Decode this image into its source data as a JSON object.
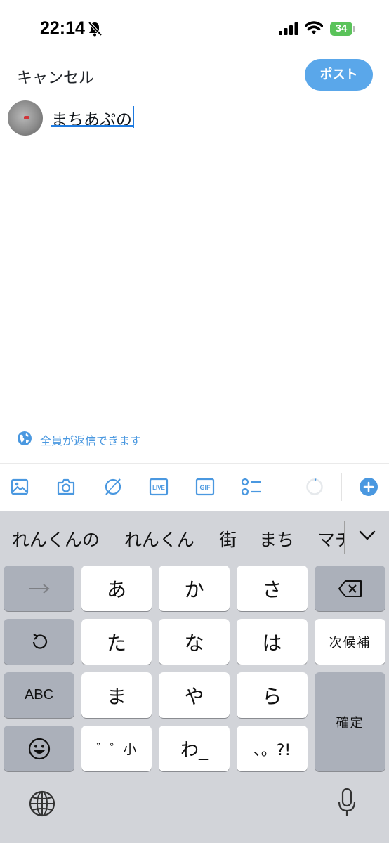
{
  "status_bar": {
    "time": "22:14",
    "battery": "34"
  },
  "header": {
    "cancel_label": "キャンセル",
    "post_label": "ポスト"
  },
  "compose": {
    "text": "まちあぷの"
  },
  "reply_setting": {
    "label": "全員が返信できます"
  },
  "toolbar": {
    "icons": [
      "image-icon",
      "camera-icon",
      "grok-icon",
      "live-icon",
      "gif-icon",
      "poll-icon",
      "character-counter-icon",
      "add-post-icon"
    ],
    "live_label": "LIVE",
    "gif_label": "GIF"
  },
  "colors": {
    "accent": "#5aa7ea",
    "link": "#4a98e0",
    "keyboard_bg": "#d2d4d9",
    "battery": "#5ac35a"
  },
  "keyboard": {
    "candidates": [
      "れんくんの",
      "れんくん",
      "街",
      "まち",
      "マチ"
    ],
    "keys": {
      "a": "あ",
      "ka": "か",
      "sa": "さ",
      "ta": "た",
      "na": "な",
      "ha": "は",
      "ma": "ま",
      "ya": "や",
      "ra": "ら",
      "dakuten": "゛゜小",
      "wa": "わ_",
      "punct": "、。?!",
      "next_candidate": "次候補",
      "abc": "ABC",
      "confirm": "確定"
    }
  }
}
